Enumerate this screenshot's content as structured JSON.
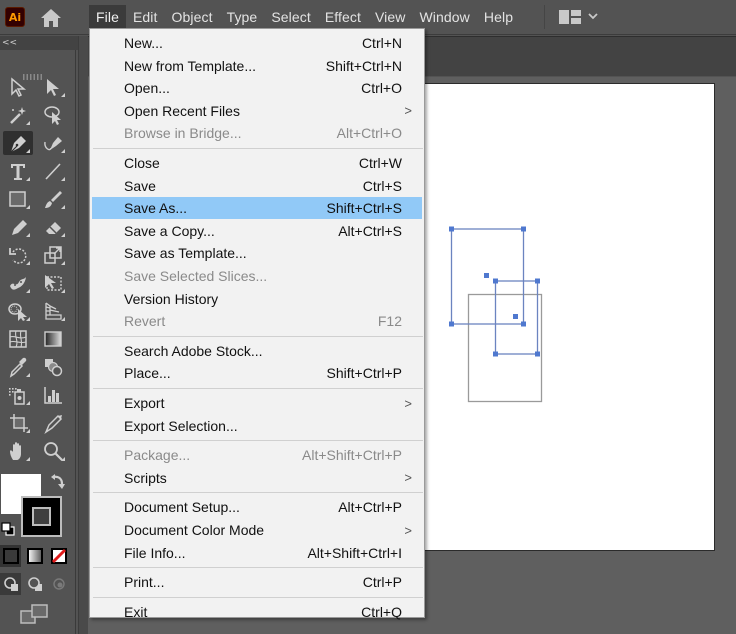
{
  "app": {
    "logo_label": "Ai",
    "menu": [
      "File",
      "Edit",
      "Object",
      "Type",
      "Select",
      "Effect",
      "View",
      "Window",
      "Help"
    ],
    "active_menu": "File"
  },
  "toolbar": {
    "collapse_label": "<<",
    "tools": [
      {
        "name": "selection-tool",
        "icon": "arrow-outline-icon"
      },
      {
        "name": "direct-selection-tool",
        "icon": "arrow-filled-icon"
      },
      {
        "name": "magic-wand-tool",
        "icon": "magic-wand-icon"
      },
      {
        "name": "lasso-tool",
        "icon": "lasso-icon"
      },
      {
        "name": "pen-tool",
        "icon": "pen-icon",
        "active": true
      },
      {
        "name": "curvature-tool",
        "icon": "curvature-icon"
      },
      {
        "name": "type-tool",
        "icon": "type-icon"
      },
      {
        "name": "line-segment-tool",
        "icon": "line-icon"
      },
      {
        "name": "rectangle-tool",
        "icon": "rectangle-icon"
      },
      {
        "name": "paintbrush-tool",
        "icon": "paintbrush-icon"
      },
      {
        "name": "shaper-tool",
        "icon": "pencil-icon"
      },
      {
        "name": "eraser-tool",
        "icon": "eraser-icon"
      },
      {
        "name": "rotate-tool",
        "icon": "rotate-icon"
      },
      {
        "name": "scale-tool",
        "icon": "scale-icon"
      },
      {
        "name": "puppet-warp-tool",
        "icon": "puppet-warp-icon"
      },
      {
        "name": "free-transform-tool",
        "icon": "free-transform-icon"
      },
      {
        "name": "shape-builder-tool",
        "icon": "shape-builder-icon"
      },
      {
        "name": "perspective-grid-tool",
        "icon": "perspective-grid-icon"
      },
      {
        "name": "mesh-tool",
        "icon": "mesh-icon"
      },
      {
        "name": "gradient-tool",
        "icon": "gradient-icon"
      },
      {
        "name": "eyedropper-tool",
        "icon": "eyedropper-icon"
      },
      {
        "name": "blend-tool",
        "icon": "blend-icon"
      },
      {
        "name": "symbol-sprayer-tool",
        "icon": "symbol-sprayer-icon"
      },
      {
        "name": "column-graph-tool",
        "icon": "column-graph-icon"
      },
      {
        "name": "artboard-tool",
        "icon": "artboard-icon"
      },
      {
        "name": "slice-tool",
        "icon": "slice-icon"
      },
      {
        "name": "hand-tool",
        "icon": "hand-icon"
      },
      {
        "name": "zoom-tool",
        "icon": "magnifier-icon"
      }
    ],
    "colors": {
      "fill": "#ffffff",
      "stroke": "#000000"
    }
  },
  "file_menu": {
    "groups": [
      [
        {
          "label": "New...",
          "shortcut": "Ctrl+N"
        },
        {
          "label": "New from Template...",
          "shortcut": "Shift+Ctrl+N"
        },
        {
          "label": "Open...",
          "shortcut": "Ctrl+O"
        },
        {
          "label": "Open Recent Files",
          "submenu": true
        },
        {
          "label": "Browse in Bridge...",
          "shortcut": "Alt+Ctrl+O",
          "disabled": true
        }
      ],
      [
        {
          "label": "Close",
          "shortcut": "Ctrl+W"
        },
        {
          "label": "Save",
          "shortcut": "Ctrl+S"
        },
        {
          "label": "Save As...",
          "shortcut": "Shift+Ctrl+S",
          "highlighted": true
        },
        {
          "label": "Save a Copy...",
          "shortcut": "Alt+Ctrl+S"
        },
        {
          "label": "Save as Template..."
        },
        {
          "label": "Save Selected Slices...",
          "disabled": true
        },
        {
          "label": "Version History"
        },
        {
          "label": "Revert",
          "shortcut": "F12",
          "disabled": true
        }
      ],
      [
        {
          "label": "Search Adobe Stock..."
        },
        {
          "label": "Place...",
          "shortcut": "Shift+Ctrl+P"
        }
      ],
      [
        {
          "label": "Export",
          "submenu": true
        },
        {
          "label": "Export Selection..."
        }
      ],
      [
        {
          "label": "Package...",
          "shortcut": "Alt+Shift+Ctrl+P",
          "disabled": true
        },
        {
          "label": "Scripts",
          "submenu": true
        }
      ],
      [
        {
          "label": "Document Setup...",
          "shortcut": "Alt+Ctrl+P"
        },
        {
          "label": "Document Color Mode",
          "submenu": true
        },
        {
          "label": "File Info...",
          "shortcut": "Alt+Shift+Ctrl+I"
        }
      ],
      [
        {
          "label": "Print...",
          "shortcut": "Ctrl+P"
        }
      ],
      [
        {
          "label": "Exit",
          "shortcut": "Ctrl+Q"
        }
      ]
    ],
    "submenu_glyph": ">",
    "highlight_color": "#91c9f7"
  },
  "canvas": {
    "selection_color": "#4f78cf",
    "unselected_stroke": "#9a9a9a"
  }
}
